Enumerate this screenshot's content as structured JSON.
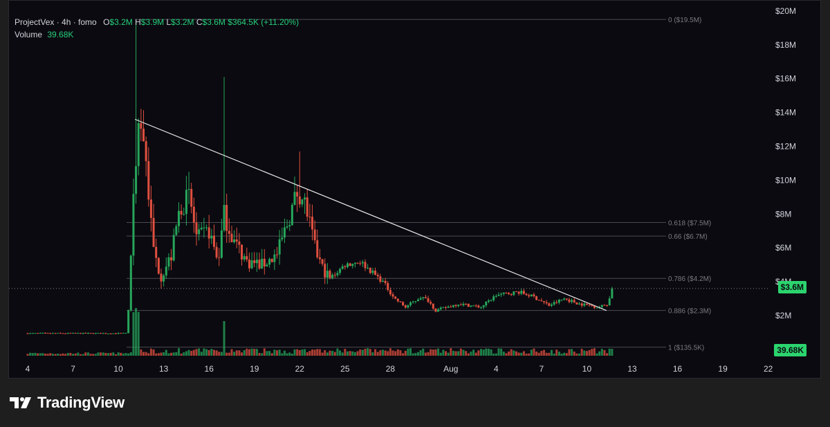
{
  "legend": {
    "symbol": "ProjectVex · 4h · fomo",
    "o_label": "O",
    "o_value": "$3.2M",
    "h_label": "H",
    "h_value": "$3.9M",
    "l_label": "L",
    "l_value": "$3.2M",
    "c_label": "C",
    "c_value": "$3.6M",
    "change": "$364.5K (+11.20%)",
    "volume_label": "Volume",
    "volume_value": "39.68K"
  },
  "price_tag": "$3.6M",
  "volume_tag": "39.68K",
  "brand": "TradingView",
  "colors": {
    "up": "#26a65b",
    "down": "#e0503f",
    "accent": "#2bd46e",
    "fib": "#4a4a50",
    "trendline": "#e8e8e8"
  },
  "chart_data": {
    "type": "candlestick",
    "timeframe": "4h",
    "y_axis": {
      "unit": "USD market cap",
      "min": 0,
      "max": 20000000,
      "ticks": [
        {
          "value": 2000000,
          "label": "$2M"
        },
        {
          "value": 4000000,
          "label": "$4M"
        },
        {
          "value": 6000000,
          "label": "$6M"
        },
        {
          "value": 8000000,
          "label": "$8M"
        },
        {
          "value": 10000000,
          "label": "$10M"
        },
        {
          "value": 12000000,
          "label": "$12M"
        },
        {
          "value": 14000000,
          "label": "$14M"
        },
        {
          "value": 16000000,
          "label": "$16M"
        },
        {
          "value": 18000000,
          "label": "$18M"
        },
        {
          "value": 20000000,
          "label": "$20M"
        }
      ]
    },
    "x_axis": {
      "unit": "day",
      "ticks": [
        {
          "day": 4,
          "label": "4"
        },
        {
          "day": 7,
          "label": "7"
        },
        {
          "day": 10,
          "label": "10"
        },
        {
          "day": 13,
          "label": "13"
        },
        {
          "day": 16,
          "label": "16"
        },
        {
          "day": 19,
          "label": "19"
        },
        {
          "day": 22,
          "label": "22"
        },
        {
          "day": 25,
          "label": "25"
        },
        {
          "day": 28,
          "label": "28"
        },
        {
          "day": 32,
          "label": "Aug"
        },
        {
          "day": 35,
          "label": "4"
        },
        {
          "day": 38,
          "label": "7"
        },
        {
          "day": 41,
          "label": "10"
        },
        {
          "day": 44,
          "label": "13"
        },
        {
          "day": 47,
          "label": "16"
        },
        {
          "day": 50,
          "label": "19"
        },
        {
          "day": 53,
          "label": "22"
        }
      ]
    },
    "fib_levels": [
      {
        "label": "0 ($19.5M)",
        "value": 19500000
      },
      {
        "label": "0.618 ($7.5M)",
        "value": 7500000
      },
      {
        "label": "0.66 ($6.7M)",
        "value": 6700000
      },
      {
        "label": "0.786 ($4.2M)",
        "value": 4200000
      },
      {
        "label": "0.886 ($2.3M)",
        "value": 2300000
      },
      {
        "label": "1 ($135.5K)",
        "value": 135500
      }
    ],
    "trendline": [
      {
        "day": 11.1,
        "value": 13600000
      },
      {
        "day": 42.3,
        "value": 2300000
      }
    ],
    "current_price": 3600000,
    "anchors": [
      {
        "day": 4.0,
        "value": 950000
      },
      {
        "day": 10.6,
        "value": 950000
      },
      {
        "day": 11.0,
        "value": 9000000
      },
      {
        "day": 11.3,
        "value": 13500000
      },
      {
        "day": 11.7,
        "value": 12500000
      },
      {
        "day": 12.3,
        "value": 6000000
      },
      {
        "day": 12.8,
        "value": 4300000
      },
      {
        "day": 13.5,
        "value": 5500000
      },
      {
        "day": 14.1,
        "value": 8500000
      },
      {
        "day": 14.7,
        "value": 9000000
      },
      {
        "day": 15.2,
        "value": 6500000
      },
      {
        "day": 16.0,
        "value": 7000000
      },
      {
        "day": 16.6,
        "value": 5200000
      },
      {
        "day": 17.0,
        "value": 8000000
      },
      {
        "day": 17.6,
        "value": 6500000
      },
      {
        "day": 18.5,
        "value": 5200000
      },
      {
        "day": 19.5,
        "value": 5000000
      },
      {
        "day": 20.5,
        "value": 5600000
      },
      {
        "day": 21.2,
        "value": 7500000
      },
      {
        "day": 21.9,
        "value": 9500000
      },
      {
        "day": 22.4,
        "value": 8500000
      },
      {
        "day": 23.0,
        "value": 6000000
      },
      {
        "day": 23.5,
        "value": 4800000
      },
      {
        "day": 24.0,
        "value": 4200000
      },
      {
        "day": 25.0,
        "value": 5000000
      },
      {
        "day": 26.0,
        "value": 5200000
      },
      {
        "day": 26.5,
        "value": 4800000
      },
      {
        "day": 27.5,
        "value": 4000000
      },
      {
        "day": 28.3,
        "value": 3000000
      },
      {
        "day": 29.0,
        "value": 2500000
      },
      {
        "day": 30.0,
        "value": 3100000
      },
      {
        "day": 30.5,
        "value": 2900000
      },
      {
        "day": 31.0,
        "value": 2300000
      },
      {
        "day": 32.5,
        "value": 2700000
      },
      {
        "day": 34.0,
        "value": 2500000
      },
      {
        "day": 35.0,
        "value": 3200000
      },
      {
        "day": 36.5,
        "value": 3400000
      },
      {
        "day": 37.5,
        "value": 3100000
      },
      {
        "day": 38.5,
        "value": 2600000
      },
      {
        "day": 39.5,
        "value": 3000000
      },
      {
        "day": 40.5,
        "value": 2700000
      },
      {
        "day": 41.8,
        "value": 2500000
      },
      {
        "day": 42.4,
        "value": 2700000
      },
      {
        "day": 42.7,
        "value": 3600000
      }
    ]
  }
}
